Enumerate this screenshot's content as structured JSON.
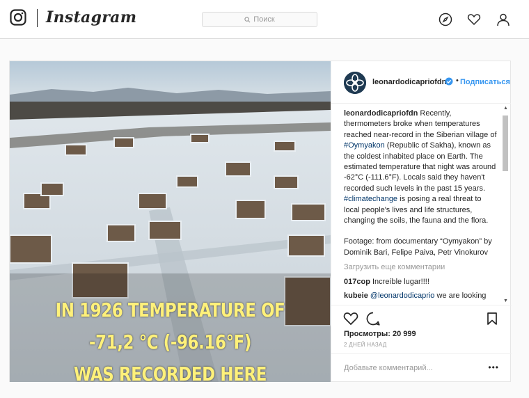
{
  "header": {
    "wordmark": "Instagram",
    "search_placeholder": "Поиск",
    "icons": [
      "instagram-logo-icon",
      "search-icon",
      "compass-icon",
      "heart-icon",
      "user-icon"
    ]
  },
  "post": {
    "username": "leonardodicapriofdn",
    "follow_label": "Подписаться",
    "video_caption": [
      "IN 1926 TEMPERATURE OF",
      "-71,2 °C (-96.16°F)",
      "WAS RECORDED HERE"
    ],
    "caption": {
      "username": "leonardodicapriofdn",
      "text_1": " Recently, thermometers broke when temperatures reached near-record in the Siberian village of ",
      "tag_1": "#Oymyakon",
      "text_2": " (Republic of Sakha), known as the coldest inhabited place on Earth. The estimated temperature that night was around -62°C (-111.6°F). Locals said they haven't recorded such levels in the past 15 years. ",
      "tag_2": "#climatechange",
      "text_3": " is posing a real threat to local people's lives and life structures, changing the soils, the fauna and the flora.",
      "footage": "Footage: from documentary “Oymyakon” by Dominik Bari, Felipe Paiva, Petr Vinokurov"
    },
    "load_more": "Загрузить еще комментарии",
    "comments": [
      {
        "user": "017cop",
        "text": " Increíble lugar!!!!"
      },
      {
        "user": "kubeie",
        "mention": "@leonardodicaprio",
        "text": " we are looking"
      }
    ],
    "views": "Просмотры: 20 999",
    "date": "2 ДНЕЙ НАЗАД",
    "add_comment_placeholder": "Добавьте комментарий...",
    "options_label": "•••"
  },
  "colors": {
    "link": "#3897f0",
    "hashtag": "#003569",
    "caption_yellow": "#fff17a"
  }
}
